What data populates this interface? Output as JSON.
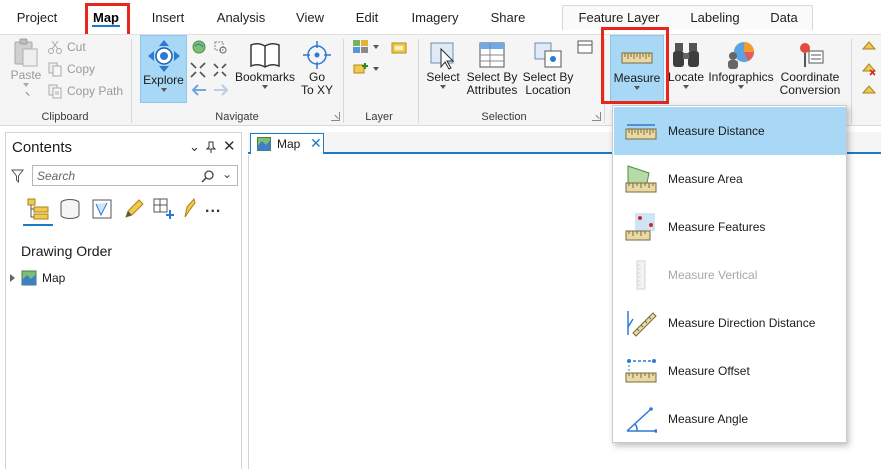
{
  "tabs": {
    "project": "Project",
    "map": "Map",
    "insert": "Insert",
    "analysis": "Analysis",
    "view": "View",
    "edit": "Edit",
    "imagery": "Imagery",
    "share": "Share"
  },
  "contextual_tabs": {
    "feature_layer": "Feature Layer",
    "labeling": "Labeling",
    "data": "Data"
  },
  "ribbon": {
    "clipboard": {
      "group": "Clipboard",
      "paste": "Paste",
      "cut": "Cut",
      "copy": "Copy",
      "copy_path": "Copy Path"
    },
    "navigate": {
      "group": "Navigate",
      "explore": "Explore",
      "bookmarks": "Bookmarks",
      "go_to_xy_line1": "Go",
      "go_to_xy_line2": "To XY"
    },
    "layer": {
      "group": "Layer"
    },
    "selection": {
      "group": "Selection",
      "select": "Select",
      "select_by_attr_1": "Select By",
      "select_by_attr_2": "Attributes",
      "select_by_loc_1": "Select By",
      "select_by_loc_2": "Location"
    },
    "inquiry": {
      "measure": "Measure",
      "locate": "Locate",
      "infographics": "Infographics",
      "coord_conv_1": "Coordinate",
      "coord_conv_2": "Conversion"
    }
  },
  "contents_pane": {
    "title": "Contents",
    "search_placeholder": "Search",
    "drawing_order": "Drawing Order",
    "layers": [
      {
        "name": "Map"
      }
    ],
    "more": "..."
  },
  "view_tab": {
    "label": "Map"
  },
  "measure_menu": {
    "items": [
      {
        "label": "Measure Distance",
        "icon": "measure-distance-icon",
        "state": "hover"
      },
      {
        "label": "Measure Area",
        "icon": "measure-area-icon",
        "state": "normal"
      },
      {
        "label": "Measure Features",
        "icon": "measure-features-icon",
        "state": "normal"
      },
      {
        "label": "Measure Vertical",
        "icon": "measure-vertical-icon",
        "state": "disabled"
      },
      {
        "label": "Measure Direction Distance",
        "icon": "measure-direction-distance-icon",
        "state": "normal"
      },
      {
        "label": "Measure Offset",
        "icon": "measure-offset-icon",
        "state": "normal"
      },
      {
        "label": "Measure Angle",
        "icon": "measure-angle-icon",
        "state": "normal"
      }
    ]
  },
  "colors": {
    "accent": "#1a7bc9",
    "highlight_red": "#e8261e",
    "hover_blue": "#a8d8f5",
    "selected_button": "#a8d8f5",
    "disabled_text": "#a8a8a8"
  }
}
